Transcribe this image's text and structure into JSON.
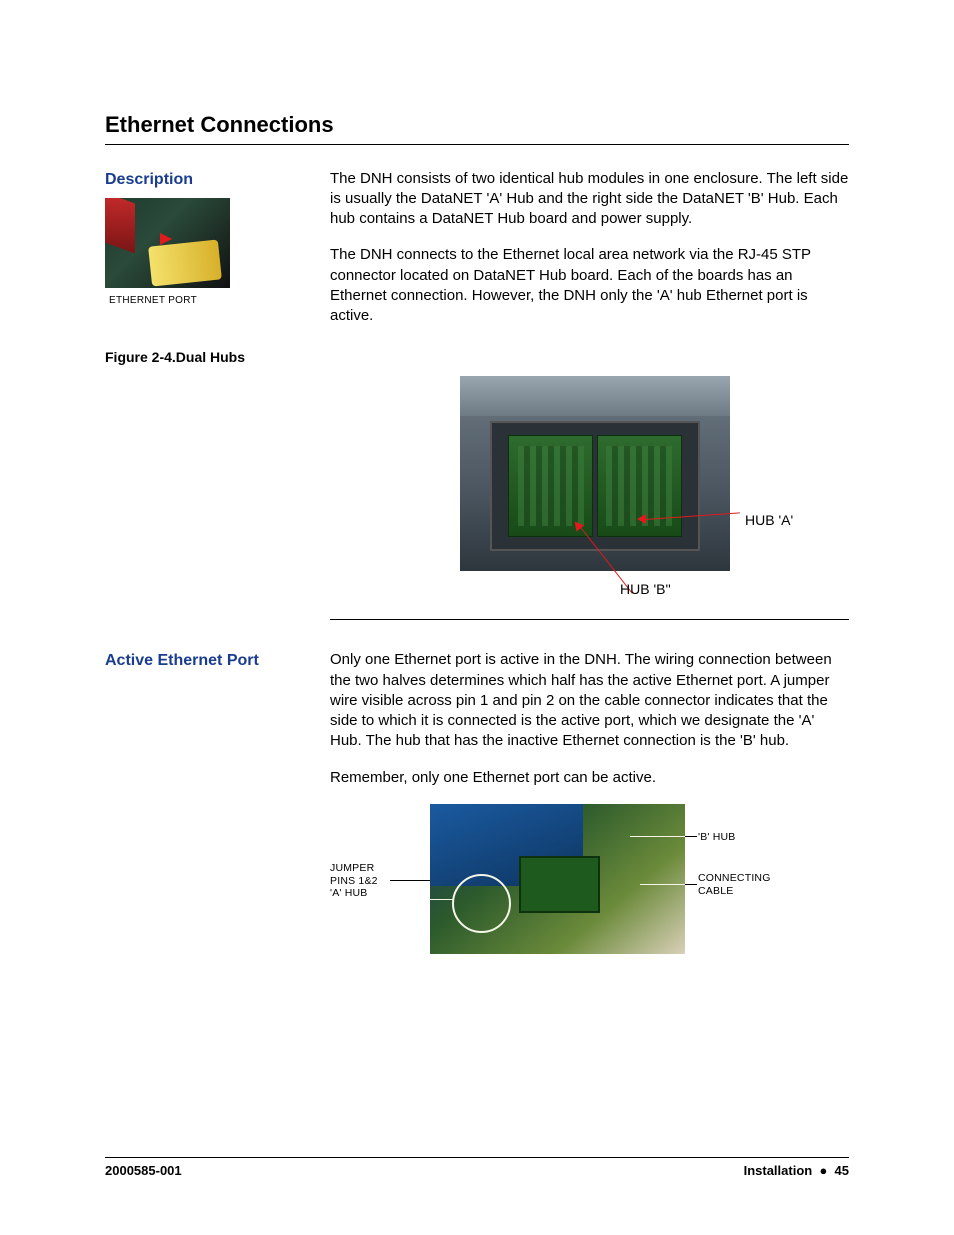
{
  "title": "Ethernet Connections",
  "section1": {
    "heading": "Description",
    "thumb_caption": "ETHERNET PORT",
    "figure_caption": "Figure 2-4.Dual Hubs",
    "para1": "The DNH consists of two identical hub modules in one enclosure. The left side is usually the DataNET 'A' Hub and the right side the DataNET 'B' Hub. Each hub contains a DataNET Hub board and power supply.",
    "para2": "The DNH connects to the Ethernet local area network via the RJ-45 STP connector located on DataNET Hub board. Each of the boards has an Ethernet connection. However, the DNH only the 'A' hub Ethernet port is active.",
    "hub_a_label": "HUB 'A'",
    "hub_b_label": "HUB 'B''"
  },
  "section2": {
    "heading": "Active Ethernet Port",
    "para1": "Only one Ethernet port is active in the DNH. The wiring connection between the two halves determines which half has the active Ethernet port. A jumper wire visible across pin 1 and pin 2 on the cable connector indicates that the side to which it is connected is the active port, which we designate the 'A' Hub. The hub that has the inactive Ethernet connection is the 'B' hub.",
    "para2": "Remember, only one Ethernet port can be active.",
    "label_jumper_l1": "JUMPER",
    "label_jumper_l2": "PINS 1&2",
    "label_jumper_l3": "'A' HUB",
    "label_bhub": "'B' HUB",
    "label_cable_l1": "CONNECTING",
    "label_cable_l2": "CABLE"
  },
  "footer": {
    "left": "2000585-001",
    "section": "Installation",
    "bullet": "●",
    "page": "45"
  }
}
